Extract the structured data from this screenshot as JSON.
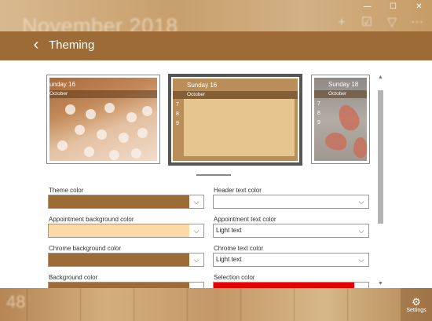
{
  "background": {
    "month_title": "November 2018",
    "bottom_number": "48",
    "settings_label": "Settings",
    "window_controls": [
      "—",
      "☐",
      "✕"
    ],
    "toolbar_icons": [
      "plus-icon",
      "checkbox-icon",
      "filter-icon",
      "more-icon"
    ]
  },
  "header": {
    "back_glyph": "‹",
    "title": "Theming"
  },
  "previews": [
    {
      "day": "unday 16",
      "month": "October",
      "numbers": []
    },
    {
      "day": "Sunday 16",
      "month": "October",
      "numbers": [
        "7",
        "8",
        "9"
      ]
    },
    {
      "day": "Sunday 18",
      "month": "October",
      "numbers": [
        "7",
        "8",
        "9"
      ]
    }
  ],
  "fields": {
    "theme_color": {
      "label": "Theme color",
      "color": "#9d6c36"
    },
    "header_text_color": {
      "label": "Header text color",
      "color": "#ffffff"
    },
    "appointment_background_color": {
      "label": "Appointment background color",
      "color": "#fddaa5"
    },
    "appointment_text_color": {
      "label": "Appointment text color",
      "value": "Light text"
    },
    "chrome_background_color": {
      "label": "Chrome background color",
      "color": "#9d6c36"
    },
    "chrome_text_color": {
      "label": "Chrome text color",
      "value": "Light text"
    },
    "background_color": {
      "label": "Background color",
      "color": "#9d6c36"
    },
    "selection_color": {
      "label": "Selection color",
      "color": "#e60000"
    }
  },
  "colors": {
    "accent": "#9d6c36",
    "panel_background": "#ffffff"
  }
}
